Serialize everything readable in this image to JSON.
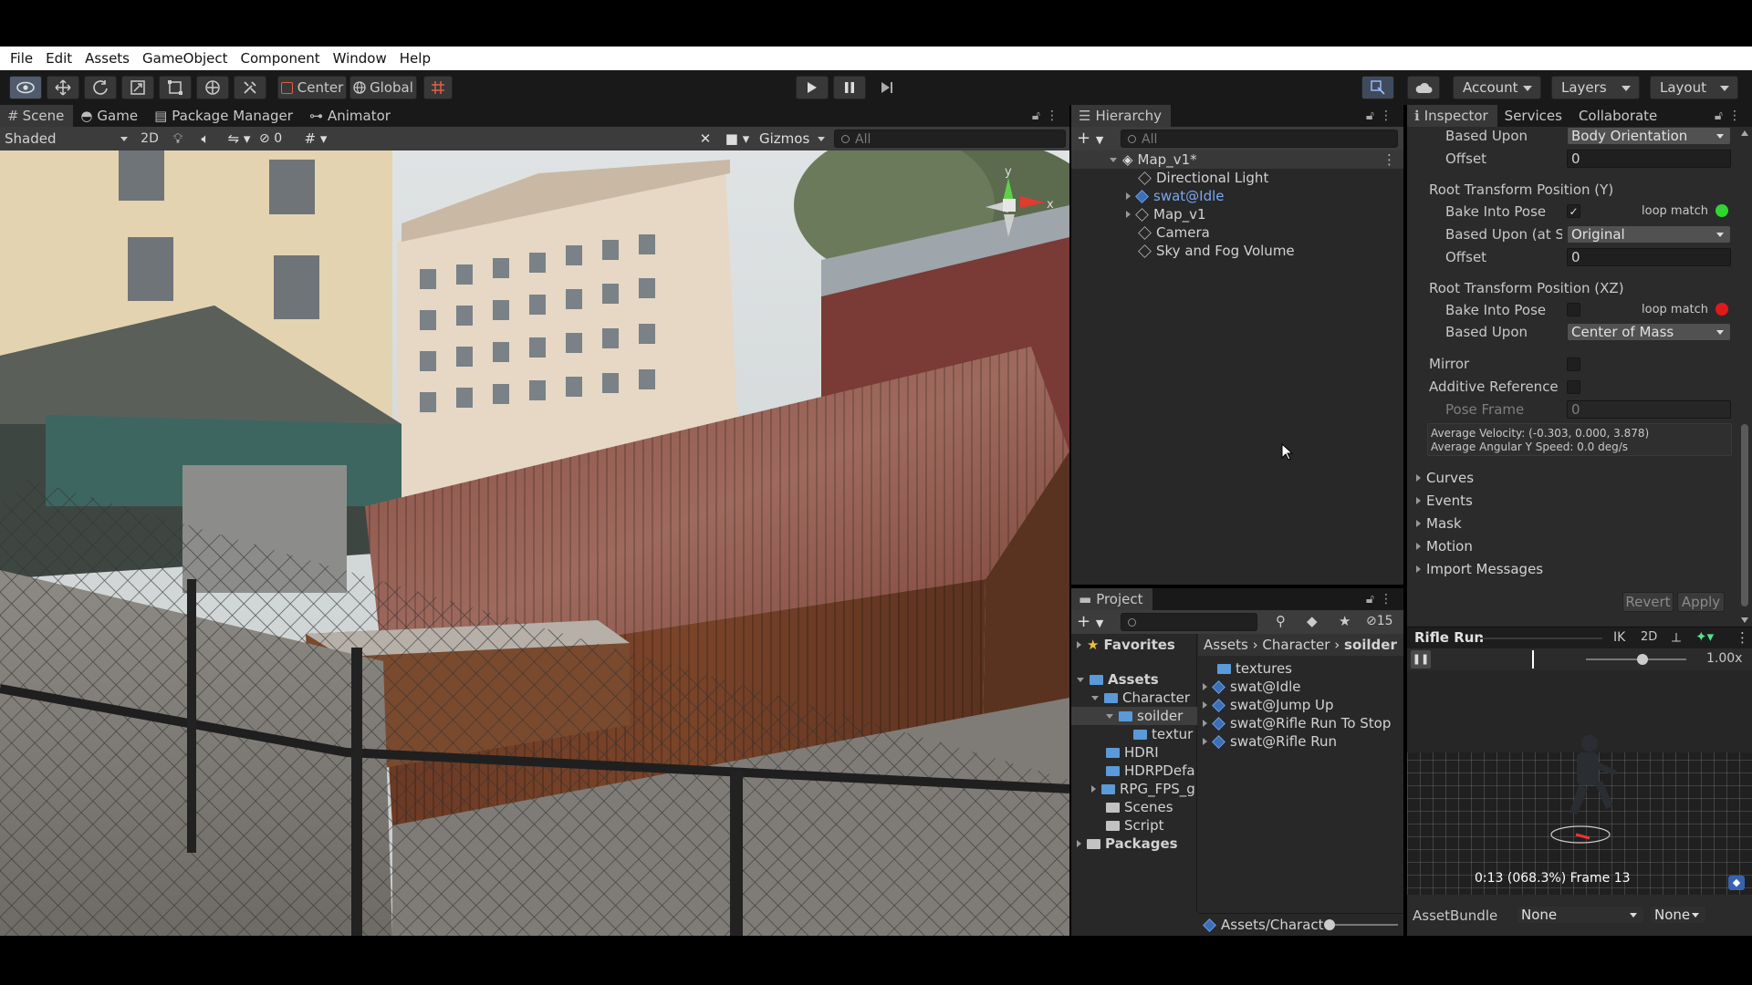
{
  "menubar": [
    "File",
    "Edit",
    "Assets",
    "GameObject",
    "Component",
    "Window",
    "Help"
  ],
  "toolbar": {
    "pivot_label": "Center",
    "space_label": "Global",
    "account_label": "Account",
    "layers_label": "Layers",
    "layout_label": "Layout"
  },
  "scene": {
    "tabs": [
      "Scene",
      "Game",
      "Package Manager",
      "Animator"
    ],
    "shading_mode": "Shaded",
    "mode_2d": "2D",
    "hidden_count": "0",
    "gizmos_label": "Gizmos",
    "search_placeholder": "All",
    "gizmo_axis_y": "y",
    "gizmo_axis_x": "x"
  },
  "hierarchy": {
    "title": "Hierarchy",
    "search_placeholder": "All",
    "scene_name": "Map_v1*",
    "items": [
      "Directional Light",
      "swat@Idle",
      "Map_v1",
      "Camera",
      "Sky and Fog Volume"
    ]
  },
  "project": {
    "title": "Project",
    "hidden_count": "15",
    "favorites_label": "Favorites",
    "tree": [
      "Assets",
      "Character",
      "soilder",
      "textur",
      "HDRI",
      "HDRPDefa",
      "RPG_FPS_g",
      "Scenes",
      "Script",
      "Packages"
    ],
    "breadcrumb": [
      "Assets",
      "Character",
      "soilder"
    ],
    "files": [
      "textures",
      "swat@Idle",
      "swat@Jump Up",
      "swat@Rifle Run To Stop",
      "swat@Rifle Run"
    ],
    "footer_path": "Assets/Charact"
  },
  "inspector": {
    "tabs": [
      "Inspector",
      "Services",
      "Collaborate"
    ],
    "based_upon_label": "Based Upon",
    "based_upon_value": "Body Orientation",
    "offset_label": "Offset",
    "offset_value": "0",
    "root_y_title": "Root Transform Position (Y)",
    "bake_label": "Bake Into Pose",
    "loop_match_label": "loop match",
    "based_upon_start_label": "Based Upon (at St",
    "based_upon_start_value": "Original",
    "offset2_value": "0",
    "root_xz_title": "Root Transform Position (XZ)",
    "bake_xz_label": "Bake Into Pose",
    "loop_match_xz_label": "loop match",
    "based_upon_xz_label": "Based Upon",
    "based_upon_xz_value": "Center of Mass",
    "mirror_label": "Mirror",
    "additive_label": "Additive Reference F",
    "pose_frame_label": "Pose Frame",
    "pose_frame_value": "0",
    "avg_velocity": "Average Velocity: (-0.303, 0.000, 3.878)",
    "avg_angular": "Average Angular Y Speed: 0.0 deg/s",
    "foldouts": [
      "Curves",
      "Events",
      "Mask",
      "Motion",
      "Import Messages"
    ],
    "revert_label": "Revert",
    "apply_label": "Apply",
    "preview_title": "Rifle Run",
    "preview_ik": "IK",
    "preview_2d": "2D",
    "preview_speed": "1.00x",
    "preview_time": "0:13 (068.3%) Frame 13",
    "assetbundle_label": "AssetBundle",
    "assetbundle_value": "None",
    "assetbundle_variant": "None",
    "loop_match_y_color": "#2fd62f",
    "loop_match_xz_color": "#e01a1a"
  }
}
